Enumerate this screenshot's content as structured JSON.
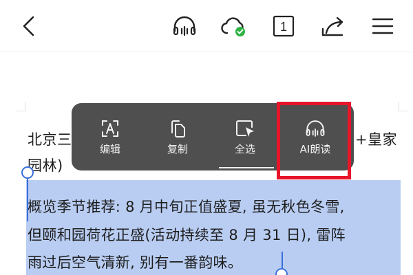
{
  "toolbar": {
    "back_icon": "chevron-left-icon",
    "listen_icon": "headphones-icon",
    "cloud_icon": "cloud-synced-icon",
    "page_number": "1",
    "share_icon": "share-icon",
    "menu_icon": "menu-icon",
    "colors": {
      "icon": "#222222",
      "sync_check": "#2fb344"
    }
  },
  "document": {
    "line_before_menu_start": "北京三",
    "line_before_menu_end": "+皇家",
    "line_continued": "园林)",
    "selected_lines": [
      "概览季节推荐: 8 月中旬正值盛夏, 虽无秋色冬雪,",
      "但颐和园荷花正盛(活动持续至 8 月 31 日), 雷阵",
      "雨过后空气清新, 别有一番韵味。"
    ],
    "colors": {
      "selection": "#b9cdf2",
      "handle": "#3a6fdc"
    }
  },
  "context_menu": {
    "items": [
      {
        "label": "编辑",
        "icon": "edit-text-icon"
      },
      {
        "label": "复制",
        "icon": "copy-icon"
      },
      {
        "label": "全选",
        "icon": "select-all-icon"
      },
      {
        "label": "AI朗读",
        "icon": "headphones-icon"
      }
    ],
    "colors": {
      "background": "#4f4f4f",
      "highlight": "#e8152a"
    }
  }
}
